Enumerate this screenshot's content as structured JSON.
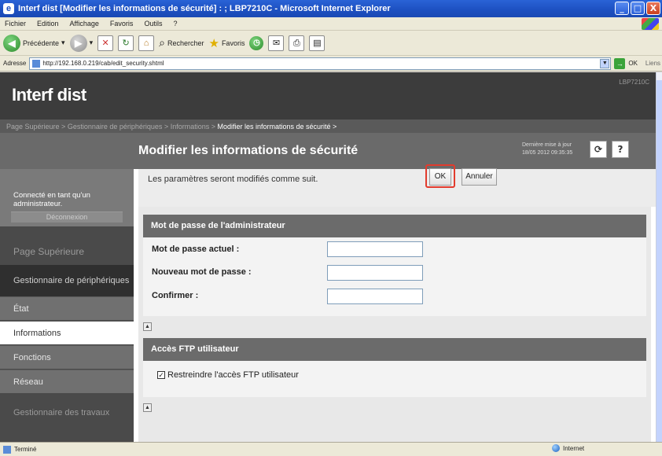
{
  "window": {
    "title": "Interf dist [Modifier les informations de sécurité] : ; LBP7210C - Microsoft Internet Explorer",
    "buttons": [
      "_",
      "□",
      "X"
    ]
  },
  "menu": [
    "Fichier",
    "Edition",
    "Affichage",
    "Favoris",
    "Outils",
    "?"
  ],
  "toolbar": {
    "back_label": "Précédente",
    "search_label": "Rechercher",
    "favorites_label": "Favoris"
  },
  "address": {
    "label": "Adresse",
    "url": "http://192.168.0.219/cab/edit_security.shtml",
    "go_label": "OK",
    "links_label": "Liens"
  },
  "app": {
    "brand": "Interf dist",
    "model": "LBP7210C"
  },
  "breadcrumb": {
    "items": [
      "Page Supérieure >",
      "Gestionnaire de périphériques >",
      "Informations >"
    ],
    "current": "Modifier les informations de sécurité >"
  },
  "page": {
    "title": "Modifier les informations de sécurité",
    "updated_line1": "Dernière mise à jour",
    "updated_line2": "18/05 2012 09:35:35",
    "refresh_icon": "refresh-icon",
    "help_label": "?"
  },
  "sidebar": {
    "status_message": "Connecté en tant qu'un administrateur.",
    "logout_label": "Déconnexion",
    "top_label": "Page Supérieure",
    "device_manager_label": "Gestionnaire de périphériques",
    "items": [
      {
        "label": "État"
      },
      {
        "label": "Informations"
      },
      {
        "label": "Fonctions"
      },
      {
        "label": "Réseau"
      }
    ],
    "job_manager_label": "Gestionnaire des travaux"
  },
  "main": {
    "note": "Les paramètres seront modifiés comme suit.",
    "ok_label": "OK",
    "cancel_label": "Annuler"
  },
  "admin_password": {
    "heading": "Mot de passe de l'administrateur",
    "current_label": "Mot de passe actuel :",
    "new_label": "Nouveau mot de passe :",
    "confirm_label": "Confirmer :",
    "current_value": "",
    "new_value": "",
    "confirm_value": ""
  },
  "ftp": {
    "heading": "Accès FTP utilisateur",
    "restrict_label": "Restreindre l'accès FTP utilisateur",
    "restrict_checked": true
  },
  "statusbar": {
    "left": "Terminé",
    "zone": "Internet"
  }
}
